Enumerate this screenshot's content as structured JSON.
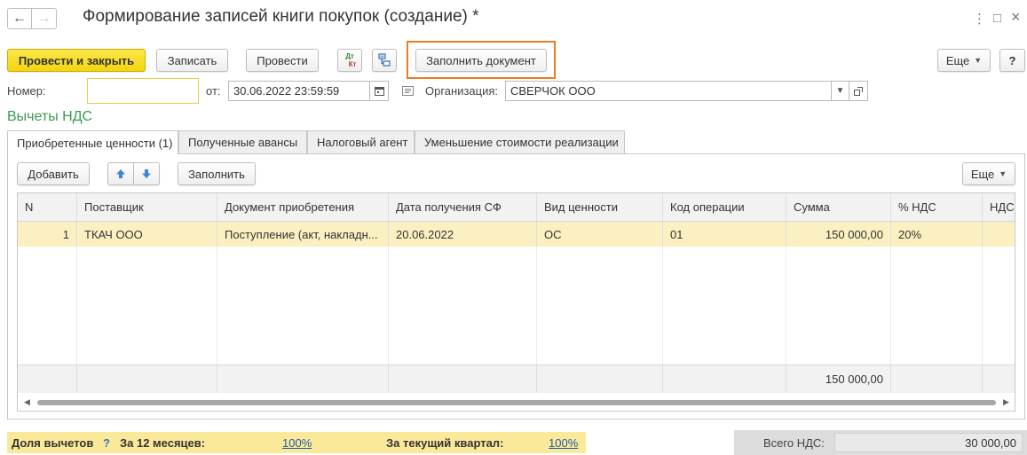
{
  "window": {
    "title": "Формирование записей книги покупок (создание) *",
    "nav_back": "←",
    "nav_forward": "→",
    "more_glyph": "⋮",
    "maximize_glyph": "□",
    "close_glyph": "×"
  },
  "toolbar": {
    "post_close": "Провести и закрыть",
    "save": "Записать",
    "post": "Провести",
    "dt_kt_top": "Дт",
    "dt_kt_bottom": "Кт",
    "fill_document": "Заполнить документ",
    "more": "Еще",
    "help": "?"
  },
  "header": {
    "number_label": "Номер:",
    "number_value": "",
    "date_label": "от:",
    "date_value": "30.06.2022 23:59:59",
    "org_label": "Организация:",
    "org_value": "СВЕРЧОК ООО"
  },
  "section_title": "Вычеты НДС",
  "tabs": [
    {
      "label": "Приобретенные ценности (1)"
    },
    {
      "label": "Полученные авансы"
    },
    {
      "label": "Налоговый агент"
    },
    {
      "label": "Уменьшение стоимости реализации"
    }
  ],
  "table_toolbar": {
    "add": "Добавить",
    "fill": "Заполнить",
    "more": "Еще"
  },
  "table": {
    "columns": [
      "N",
      "Поставщик",
      "Документ приобретения",
      "Дата получения СФ",
      "Вид ценности",
      "Код операции",
      "Сумма",
      "% НДС",
      "НДС"
    ],
    "rows": [
      [
        "1",
        "ТКАЧ ООО",
        "Поступление (акт, накладн...",
        "20.06.2022",
        "ОС",
        "01",
        "150 000,00",
        "20%",
        ""
      ]
    ],
    "footer_sum": "150 000,00"
  },
  "bottom": {
    "share_label": "Доля вычетов",
    "help": "?",
    "months_label": "За 12 месяцев:",
    "months_value": "100%",
    "quarter_label": "За текущий квартал:",
    "quarter_value": "100%",
    "total_label": "Всего НДС:",
    "total_value": "30 000,00"
  },
  "colors": {
    "primary_button": "#f4d50f",
    "highlight_border": "#ec7b26",
    "section_title": "#3c9a52",
    "selected_row": "#fbf0c1",
    "link": "#1f5aa8"
  }
}
